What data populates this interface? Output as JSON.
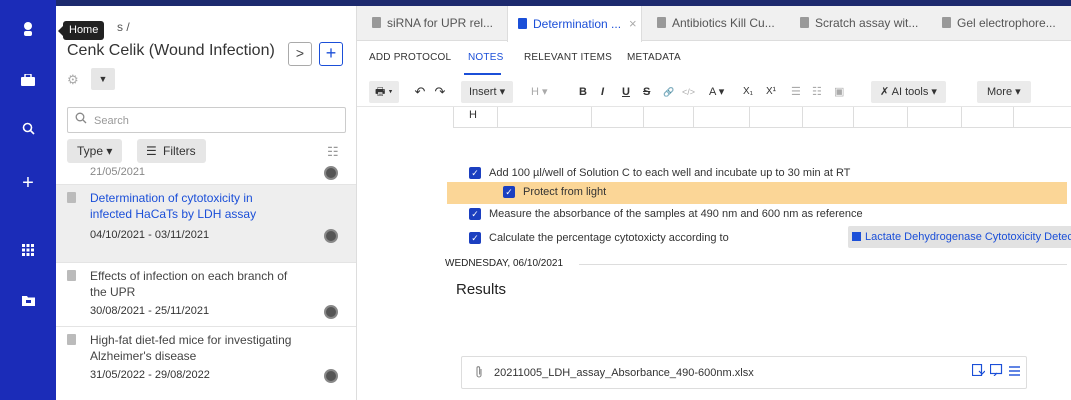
{
  "tooltip": {
    "text": "Home"
  },
  "rail": {
    "icons": [
      "avatar-icon",
      "briefcase-icon",
      "search-icon",
      "plus-icon",
      "apps-grid-icon",
      "folder-icon"
    ]
  },
  "sidebar": {
    "breadcrumb": "s /",
    "title": "Cenk Celik (Wound Infection)",
    "next_label": ">",
    "add_label": "+",
    "caret": "▼",
    "search_placeholder": "Search",
    "type_label": "Type ▾",
    "filters_label": "Filters",
    "items": [
      {
        "title": "",
        "date": "21/05/2021"
      },
      {
        "title": "Determination of cytotoxicity in infected HaCaTs by LDH assay",
        "date": "04/10/2021 - 03/11/2021"
      },
      {
        "title": "Effects of infection on each branch of the UPR",
        "date": "30/08/2021 - 25/11/2021"
      },
      {
        "title": "High-fat diet-fed mice for investigating Alzheimer's disease",
        "date": "31/05/2022 - 29/08/2022"
      }
    ]
  },
  "tabs": [
    {
      "label": "siRNA for UPR rel..."
    },
    {
      "label": "Determination ...",
      "close": "×"
    },
    {
      "label": "Antibiotics Kill Cu..."
    },
    {
      "label": "Scratch assay wit..."
    },
    {
      "label": "Gel electrophore..."
    }
  ],
  "subtabs": [
    "ADD PROTOCOL",
    "NOTES",
    "RELEVANT ITEMS",
    "METADATA"
  ],
  "toolbar": {
    "print": "🖶 ▾",
    "undo": "↶",
    "redo": "↷",
    "insert": "Insert ▾",
    "heading": "H ▾",
    "bold": "B",
    "italic": "I",
    "underline": "U",
    "strike": "S",
    "link": "🔗",
    "code": "</>",
    "font_color": "A ▾",
    "subscript": "X₁",
    "superscript": "X¹",
    "bullet_list": "☰",
    "numbered_list": "☷",
    "checklist": "▣",
    "ai_tools": "✗ AI tools ▾",
    "more": "More ▾"
  },
  "editor": {
    "table_header": "H",
    "tasks": [
      {
        "text": "Add 100 µl/well of Solution C to each well and incubate up to 30 min at RT",
        "highlight": false
      },
      {
        "text": "Protect from light",
        "highlight": true
      },
      {
        "text": "Measure the absorbance of the samples at 490 nm and 600 nm as reference",
        "highlight": false
      },
      {
        "text": "Calculate the percentage cytotoxicty according to",
        "highlight": false
      }
    ],
    "link_chip": "Lactate Dehydrogenase Cytotoxicity Detection Assay",
    "date_separator": "WEDNESDAY, 06/10/2021",
    "results_heading": "Results",
    "attachment": {
      "filename": "20211005_LDH_assay_Absorbance_490-600nm.xlsx"
    }
  },
  "colors": {
    "rail": "#1b2cb8",
    "accent": "#1b4fd8",
    "highlight": "#fbd697"
  }
}
